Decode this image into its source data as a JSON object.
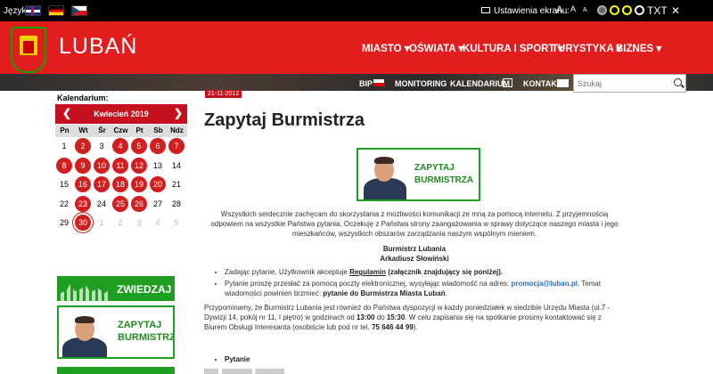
{
  "topbar": {
    "language_label": "Język:",
    "languages": [
      "English",
      "Deutsch",
      "Čeština"
    ],
    "screen_settings_label": "Ustawienia ekranu:",
    "font_sizes": [
      "A",
      "A",
      "A"
    ],
    "text_mode": "TXT",
    "close": "✕"
  },
  "header": {
    "brand": "LUBAŃ",
    "nav": [
      "MIASTO ▾",
      "OŚWIATA ▾",
      "KULTURA I SPORT ▾",
      "TURYSTYKA ▾",
      "BIZNES ▾"
    ],
    "utility": [
      "BIP",
      "MONITORING",
      "KALENDARIUM",
      "KONTAKT"
    ],
    "search_placeholder": "Szukaj"
  },
  "calendar": {
    "label": "Kalendarium:",
    "title": "Kwiecień 2019",
    "prev": "❮",
    "next": "❯",
    "weekdays": [
      "Pn",
      "Wt",
      "Śr",
      "Czw",
      "Pt",
      "Sb",
      "Ndz"
    ],
    "days": [
      "1",
      "2",
      "3",
      "4",
      "5",
      "6",
      "7",
      "8",
      "9",
      "10",
      "11",
      "12",
      "13",
      "14",
      "15",
      "16",
      "17",
      "18",
      "19",
      "20",
      "21",
      "22",
      "23",
      "24",
      "25",
      "26",
      "27",
      "28",
      "29",
      "30",
      "1",
      "2",
      "3",
      "4",
      "5"
    ]
  },
  "sidebar": {
    "zwiedzaj": "ZWIEDZAJ",
    "banner_line1": "ZAPYTAJ",
    "banner_line2": "BURMISTRZA"
  },
  "article": {
    "date": "21-11-2012",
    "title": "Zapytaj Burmistrza",
    "banner_line1": "ZAPYTAJ",
    "banner_line2": "BURMISTRZA",
    "intro": "Wszystkich serdecznie zachęcam do skorzystania z możliwości komunikacji ze mną za pomocą internetu. Z przyjemnością odpowiem na wszystkie Państwa pytania. Oczekuję z Państwa strony zaangażowania w sprawy dotyczące naszego miasta i jego mieszkańców, wszystkich obszarów zarządzania naszym wspólnym mieniem.",
    "signature_line1": "Burmistrz Lubania",
    "signature_line2": "Arkadiusz Słowiński",
    "bullet1_a": "Zadając pytanie, Użytkownik akceptuje ",
    "bullet1_link": "Regulamin",
    "bullet1_b": " (załącznik znajdujący się poniżej).",
    "bullet2_a": "Pytanie proszę przesłać za pomocą poczty elektronicznej, wysyłając wiadomość na adres: ",
    "bullet2_email": "promocja@luban.pl",
    "bullet2_b": ". Temat wiadomości powinien brzmieć: ",
    "bullet2_subject": "pytanie do Burmistrza Miasta Lubań",
    "bullet2_end": ".",
    "remind_a": "Przypominamy, że Burmistrz Lubania jest również do Państwa dyspozycji w każdy poniedziałek w siedzibie Urzędu Miasta (ul.7 - Dywizji 14, pokój nr 11, I piętro) w godzinach od ",
    "remind_from": "13:00",
    "remind_mid": " do ",
    "remind_to": "15:30",
    "remind_b": ". W celu zapisania się na spotkanie prosimy kontaktować się z Biurem Obsługi Interesanta (osobiście lub pod nr tel. ",
    "remind_phone": "75 646 44 99",
    "remind_end": ").",
    "list_item": "Pytanie"
  }
}
